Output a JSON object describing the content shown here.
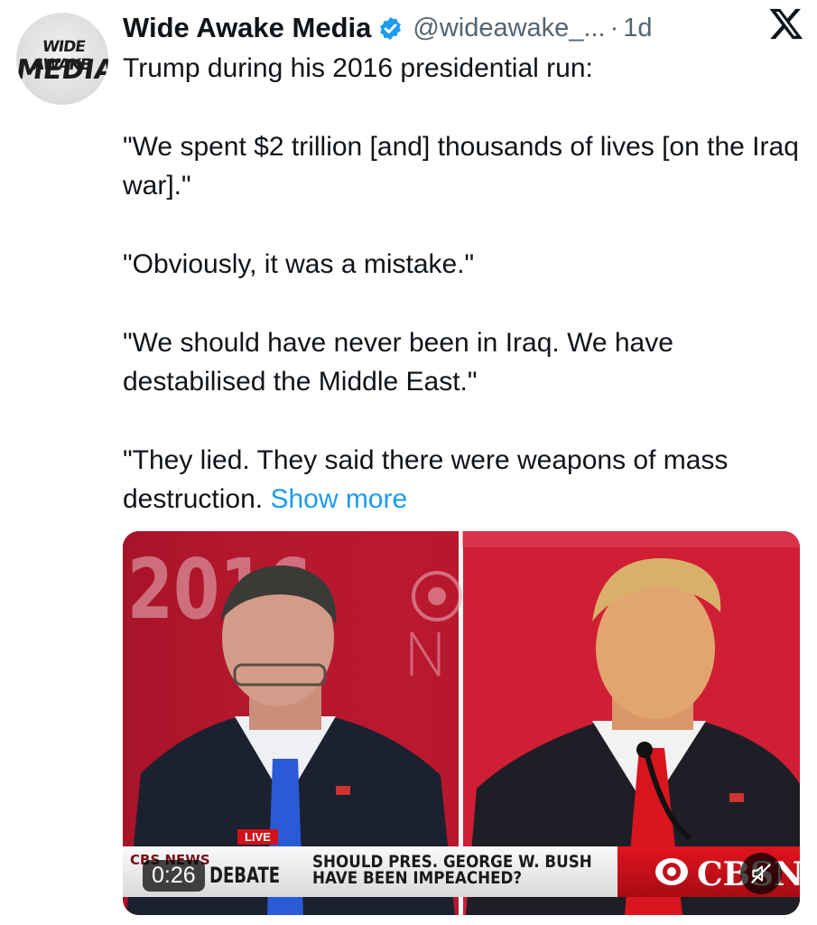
{
  "author": {
    "display_name": "Wide Awake Media",
    "handle": "@wideawake_...",
    "time": "1d",
    "avatar_text_line1": "WIDE AWAKE",
    "avatar_text_line2": "MEDIA",
    "verified": true
  },
  "tweet": {
    "paragraphs": [
      "Trump during his 2016 presidential run:",
      "\"We spent $2 trillion [and] thousands of lives [on the Iraq war].\"",
      "\"Obviously, it was a mistake.\"",
      "\"We should have never been in Iraq. We have destabilised the Middle East.\""
    ],
    "last_paragraph": "\"They lied. They said there were weapons of mass destruction.",
    "show_more": "Show more"
  },
  "media": {
    "timestamp": "0:26",
    "live_badge": "LIVE",
    "lower_third_small": "CBS NEWS",
    "lower_third_left": "DEBATE",
    "headline_line1": "SHOULD PRES. GEORGE W. BUSH",
    "headline_line2": "HAVE BEEN IMPEACHED?",
    "network": "CBSN",
    "bg_year_left": "2016"
  },
  "colors": {
    "link": "#1d9bf0",
    "verified": "#1d9bf0",
    "secondary_text": "#536471",
    "stage_red": "#c41e3a"
  },
  "icons": {
    "close": "x-logo-icon",
    "verified": "verified-badge-icon",
    "mute": "muted-speaker-icon"
  }
}
